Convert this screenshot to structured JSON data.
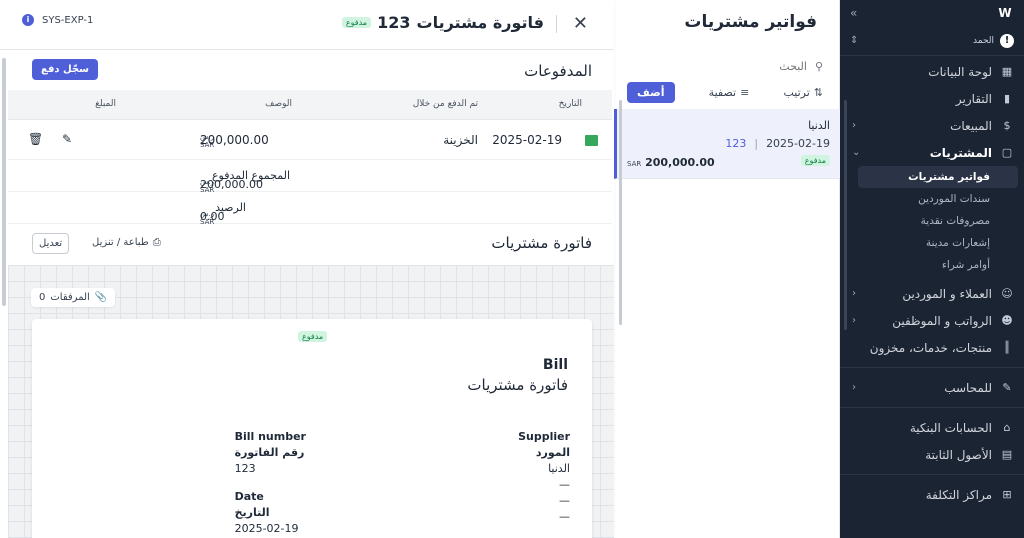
{
  "sidebar": {
    "org_name": "الحمد",
    "items": [
      {
        "label": "لوحة البيانات",
        "icon": "grid-icon"
      },
      {
        "label": "التقارير",
        "icon": "chart-icon"
      },
      {
        "label": "المبيعات",
        "icon": "dollar-icon"
      },
      {
        "label": "المشتريات",
        "icon": "clipboard-icon"
      },
      {
        "label": "العملاء و الموردين",
        "icon": "users-icon"
      },
      {
        "label": "الرواتب و الموظفين",
        "icon": "user-card-icon"
      },
      {
        "label": "منتجات، خدمات، مخزون",
        "icon": "barcode-icon"
      },
      {
        "label": "للمحاسب",
        "icon": "calculator-icon"
      },
      {
        "label": "الحسابات البنكية",
        "icon": "bank-icon"
      },
      {
        "label": "الأصول الثابتة",
        "icon": "building-icon"
      },
      {
        "label": "مراكز التكلفة",
        "icon": "squares-icon"
      }
    ],
    "purchases_sub": [
      "فواتير مشتريات",
      "سندات الموردين",
      "مصروفات نقدية",
      "إشعارات مدينة",
      "أوامر شراء"
    ]
  },
  "list": {
    "title": "فواتير مشتريات",
    "search_placeholder": "البحث",
    "sort_label": "ترتيب",
    "filter_label": "تصفية",
    "add_label": "أضف",
    "row": {
      "name": "الدنيا",
      "date": "2025-02-19",
      "number": "123",
      "status": "مدفوع",
      "amount": "200,000.00",
      "currency": "SAR"
    }
  },
  "detail": {
    "title": "فاتورة مشتريات",
    "number": "123",
    "status": "مدفوع",
    "code": "SYS-EXP-1",
    "payments": {
      "title": "المدفوعات",
      "record_button": "سجّل دفع",
      "columns": {
        "date": "التاريخ",
        "paid_via": "تم الدفع من خلال",
        "description": "الوصف",
        "amount": "المبلغ"
      },
      "row": {
        "date": "2025-02-19",
        "paid_via": "الخزينة",
        "amount": "200,000.00",
        "currency": "ر.س SAR"
      },
      "total_label": "المجموع المدفوع",
      "total_amount": "200,000.00",
      "total_currency": "ر.س SAR",
      "balance_label": "الرصيد",
      "balance_amount": "0.00",
      "balance_currency": "ر.س SAR"
    },
    "bill_section": {
      "title": "فاتورة مشتريات",
      "print_label": "طباعة / تنزيل",
      "edit_label": "تعديل",
      "attachments_label": "المرفقات",
      "attachments_count": "0"
    },
    "paper": {
      "status": "مدفوع",
      "bill_en": "Bill",
      "bill_ar": "فاتورة مشتريات",
      "supplier_en": "Supplier",
      "supplier_ar": "المورد",
      "supplier_name": "الدنيا",
      "dash1": "—",
      "dash2": "—",
      "dash3": "—",
      "bill_number_en": "Bill number",
      "bill_number_ar": "رقم الفاتورة",
      "bill_number": "123",
      "date_en": "Date",
      "date_ar": "التاريخ",
      "date": "2025-02-19"
    }
  }
}
